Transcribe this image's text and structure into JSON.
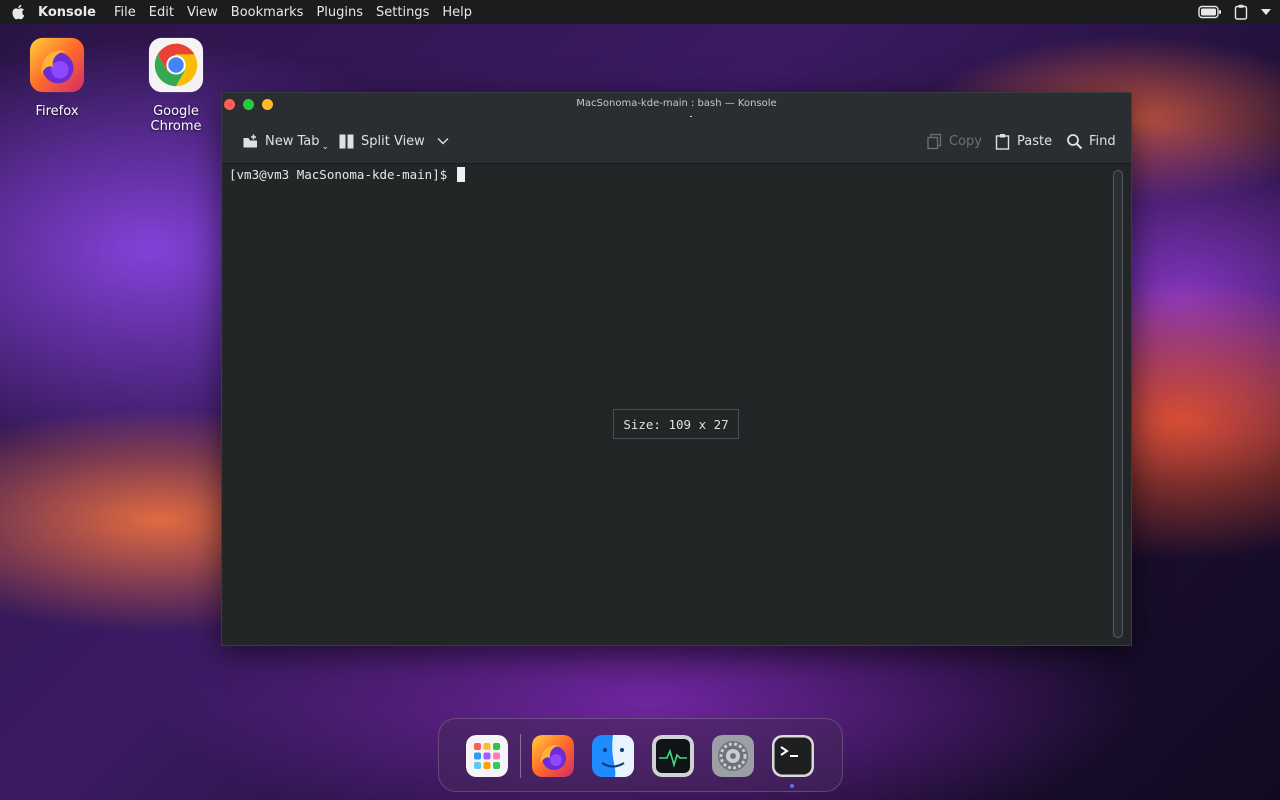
{
  "menubar": {
    "app_name": "Konsole",
    "items": [
      "File",
      "Edit",
      "View",
      "Bookmarks",
      "Plugins",
      "Settings",
      "Help"
    ]
  },
  "desktop": {
    "icons": [
      {
        "label": "Firefox",
        "icon": "firefox-icon"
      },
      {
        "label": "Google Chrome",
        "icon": "chrome-icon"
      }
    ]
  },
  "window": {
    "title": "MacSonoma-kde-main : bash — Konsole",
    "toolbar": {
      "new_tab": "New Tab",
      "split_view": "Split View",
      "copy": "Copy",
      "paste": "Paste",
      "find": "Find"
    },
    "terminal": {
      "prompt": "[vm3@vm3 MacSonoma-kde-main]$ ",
      "size_tooltip": "Size: 109 x 27"
    }
  },
  "dock": {
    "items": [
      {
        "name": "launchpad",
        "icon": "launchpad-icon"
      },
      {
        "name": "firefox",
        "icon": "firefox-icon"
      },
      {
        "name": "finder",
        "icon": "finder-icon"
      },
      {
        "name": "activity-monitor",
        "icon": "activity-monitor-icon"
      },
      {
        "name": "system-settings",
        "icon": "gear-icon"
      },
      {
        "name": "terminal",
        "icon": "terminal-icon"
      }
    ]
  },
  "colors": {
    "menubar_bg": "#1b1c1e",
    "terminal_bg": "#232627",
    "close": "#ff5f56",
    "minimize": "#27c93f",
    "maximize": "#ffbd2e"
  }
}
